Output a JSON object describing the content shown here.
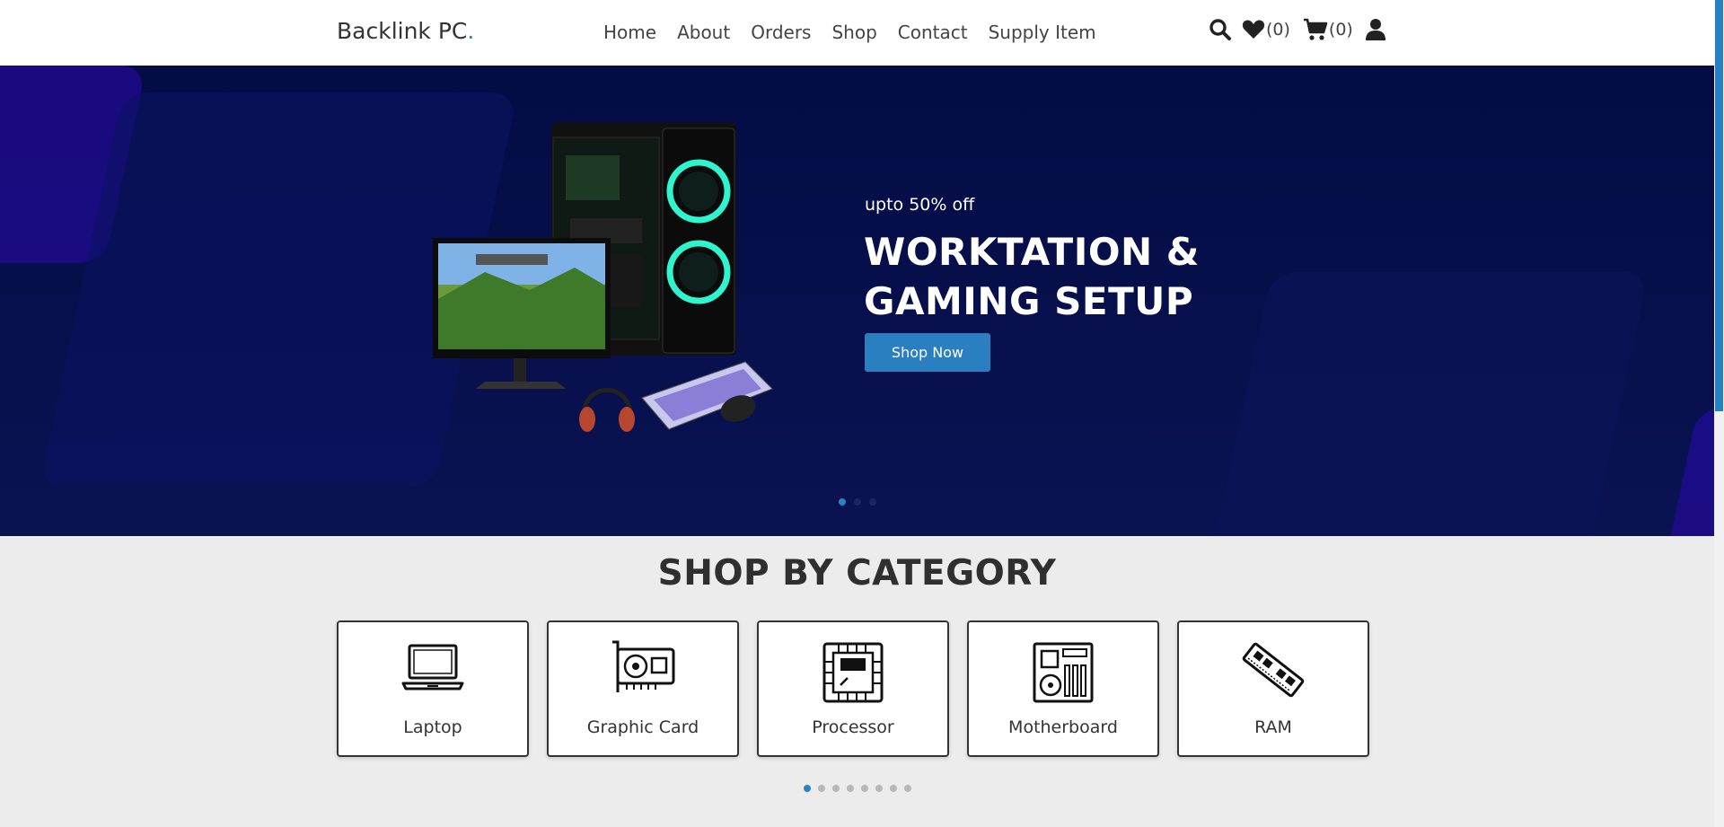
{
  "header": {
    "brand_text": "Backlink PC",
    "brand_dot": ".",
    "nav": [
      "Home",
      "About",
      "Orders",
      "Shop",
      "Contact",
      "Supply Item"
    ],
    "wishlist_count": "(0)",
    "cart_count": "(0)"
  },
  "hero": {
    "promo": "upto 50% off",
    "headline": "WORKTATION & GAMING SETUP",
    "button": "Shop Now",
    "slide_count": 3,
    "active_slide": 1
  },
  "categories": {
    "title": "SHOP BY CATEGORY",
    "items": [
      {
        "label": "Laptop",
        "icon": "laptop-icon"
      },
      {
        "label": "Graphic Card",
        "icon": "graphic-card-icon"
      },
      {
        "label": "Processor",
        "icon": "processor-icon"
      },
      {
        "label": "Motherboard",
        "icon": "motherboard-icon"
      },
      {
        "label": "RAM",
        "icon": "ram-icon"
      }
    ],
    "page_count": 8,
    "active_page": 1
  },
  "colors": {
    "accent": "#2a7fc0",
    "hero_bg": "#040c45",
    "text_dark": "#333333"
  }
}
